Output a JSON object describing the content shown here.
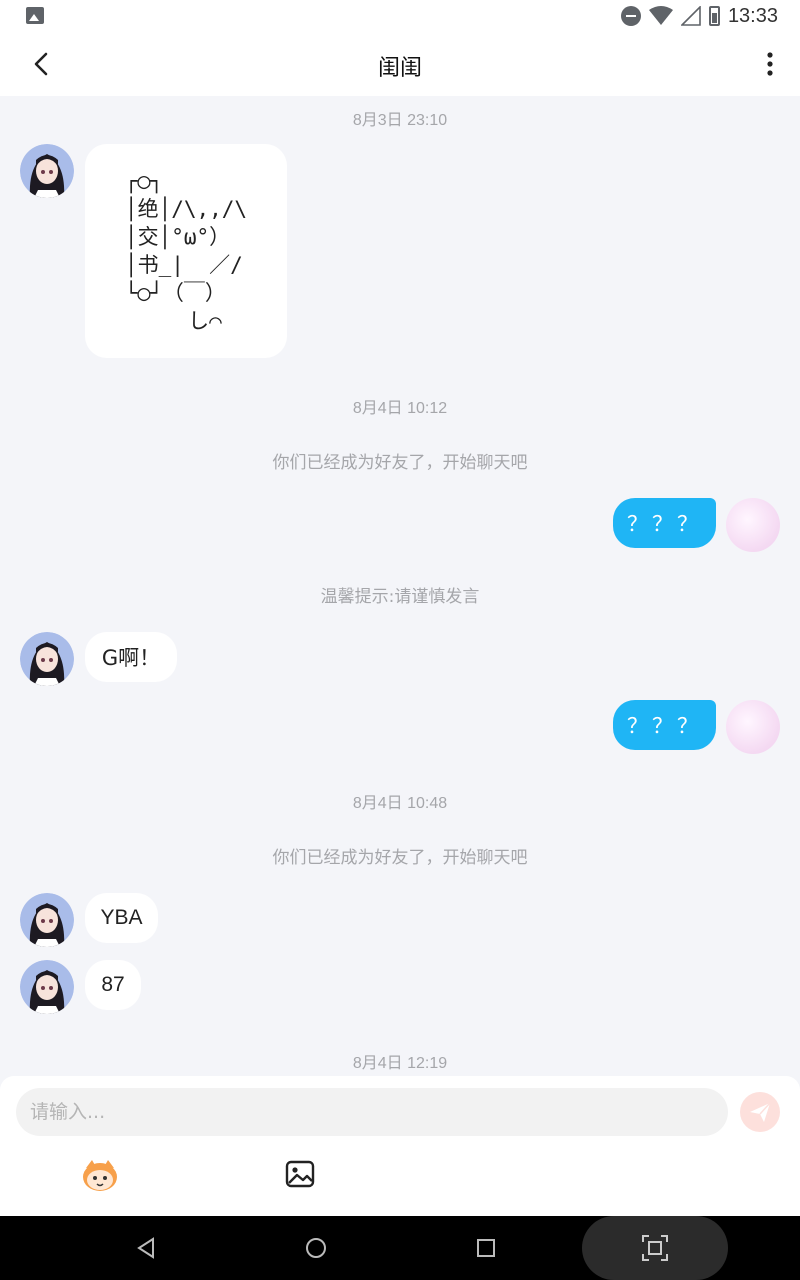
{
  "status_bar": {
    "time": "13:33"
  },
  "header": {
    "title": "闺闺"
  },
  "chat": {
    "timestamps": [
      "8月3日 23:10",
      "8月4日 10:12",
      "8月4日 10:48",
      "8月4日 12:19"
    ],
    "system_messages": [
      "你们已经成为好友了，开始聊天吧",
      "温馨提示:请谨慎发言",
      "你们已经成为好友了，开始聊天吧"
    ],
    "messages": [
      {
        "from": "friend",
        "text": "┌◯┐\n│绝│/\\,,/\\\n│交│°ω°）\n│书_|  ／/\n└◯┘（￣）\n     し⌒"
      },
      {
        "from": "me",
        "text": "？？？"
      },
      {
        "from": "friend",
        "text": "G啊！"
      },
      {
        "from": "me",
        "text": "？？？"
      },
      {
        "from": "friend",
        "text": "YBA"
      },
      {
        "from": "friend",
        "text": "87"
      }
    ]
  },
  "input": {
    "placeholder": "请输入..."
  },
  "icons": {
    "back": "chevron-left-icon",
    "more": "more-vert-icon",
    "send": "send-icon",
    "emoji": "emoji-face-icon",
    "image": "image-icon"
  },
  "colors": {
    "outgoing_bubble": "#1fb5f5",
    "background": "#f4f5f9",
    "send_button": "#fde0dc"
  }
}
